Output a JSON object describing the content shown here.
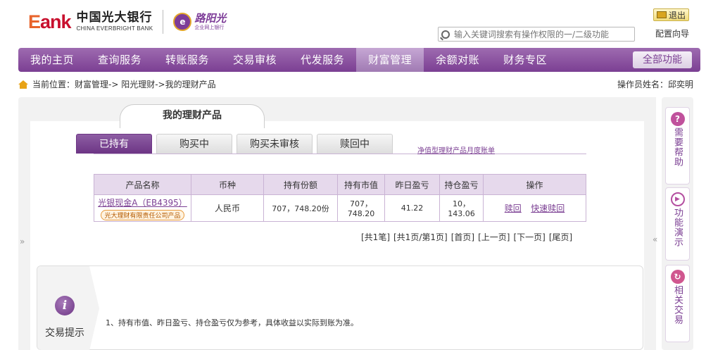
{
  "header": {
    "logo_bank": "Bank",
    "logo_cn": "中国光大银行",
    "logo_en": "CHINA EVERBRIGHT BANK",
    "sub_logo_title": "路阳光",
    "sub_logo_sub": "企业网上银行",
    "search_placeholder": "输入关键词搜索有操作权限的一/二级功能",
    "logout_label": "退出",
    "config_label": "配置向导"
  },
  "nav": {
    "items": [
      {
        "label": "我的主页"
      },
      {
        "label": "查询服务"
      },
      {
        "label": "转账服务"
      },
      {
        "label": "交易审核"
      },
      {
        "label": "代发服务"
      },
      {
        "label": "财富管理"
      },
      {
        "label": "余额对账"
      },
      {
        "label": "财务专区"
      }
    ],
    "active_index": 5,
    "all_label": "全部功能"
  },
  "breadcrumb": {
    "text": "当前位置：财富管理-> 阳光理财->我的理财产品"
  },
  "operator": {
    "text": "操作员姓名：邱奕明"
  },
  "page": {
    "title": "我的理财产品",
    "tabs": [
      {
        "label": "已持有"
      },
      {
        "label": "购买中"
      },
      {
        "label": "购买未审核"
      },
      {
        "label": "赎回中"
      }
    ],
    "active_tab": 0,
    "monthly_link": "净值型理财产品月度账单"
  },
  "table": {
    "headers": [
      "产品名称",
      "币种",
      "持有份额",
      "持有市值",
      "昨日盈亏",
      "持仓盈亏",
      "操作"
    ],
    "rows": [
      {
        "name": "光银现金A（EB4395）",
        "issuer": "光大理财有限责任公司产品",
        "currency": "人民币",
        "shares": "707，748.20份",
        "market_value": "707，748.20",
        "yesterday_pl": "41.22",
        "position_pl": "10，143.06",
        "ops": [
          "赎回",
          "快速赎回"
        ]
      }
    ]
  },
  "pager": {
    "items": [
      "[共1笔]",
      "[共1页/第1页]",
      "[首页]",
      "[上一页]",
      "[下一页]",
      "[尾页]"
    ]
  },
  "tips": {
    "title": "交易提示",
    "text": "1、持有市值、昨日盈亏、持仓盈亏仅为参考，具体收益以实际到账为准。"
  },
  "sidebar": {
    "items": [
      {
        "label": "需要帮助",
        "icon": "help-icon",
        "color": "#c0519c"
      },
      {
        "label": "功能演示",
        "icon": "play-icon",
        "color": "#b44fa0"
      },
      {
        "label": "相关交易",
        "icon": "swap-icon",
        "color": "#d0568f"
      }
    ]
  },
  "fold_left": "»",
  "fold_right": "«"
}
